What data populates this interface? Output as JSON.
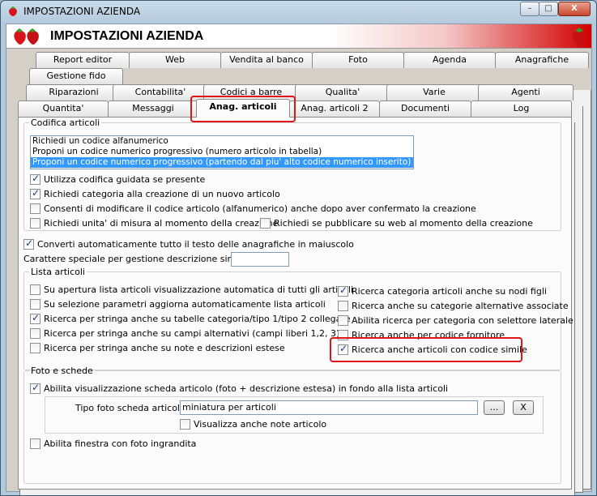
{
  "window": {
    "title": "IMPOSTAZIONI AZIENDA",
    "header_title": "IMPOSTAZIONI AZIENDA",
    "controls": {
      "minimize": "–",
      "maximize": "□",
      "close": "X"
    }
  },
  "tabs": {
    "row1": [
      "Report editor",
      "Web",
      "Vendita al banco",
      "Foto",
      "Agenda",
      "Anagrafiche"
    ],
    "row1b": [
      "Gestione fido"
    ],
    "row2": [
      "Riparazioni",
      "Contabilita'",
      "Codici a barre",
      "Qualita'",
      "Varie",
      "Agenti"
    ],
    "row3": [
      "Quantita'",
      "Messaggi",
      "Anag. articoli",
      "Anag. articoli 2",
      "Documenti",
      "Log"
    ],
    "active": "Anag. articoli"
  },
  "codifica": {
    "legend": "Codifica articoli",
    "options": [
      "Richiedi un codice alfanumerico",
      "Proponi un codice numerico progressivo (numero articolo in tabella)",
      "Proponi un codice numerico progressivo (partendo dal piu' alto codice numerico inserito)"
    ],
    "selected_index": 2,
    "checks": [
      {
        "label": "Utilizza codifica guidata se presente",
        "checked": true
      },
      {
        "label": "Richiedi categoria alla creazione di un nuovo articolo",
        "checked": true
      },
      {
        "label": "Consenti di modificare il codice articolo (alfanumerico) anche dopo aver confermato la creazione",
        "checked": false
      },
      {
        "label": "Richiedi unita' di misura al momento della creazione",
        "checked": false
      },
      {
        "label": "Richiedi se pubblicare su web al momento della creazione",
        "checked": false
      }
    ]
  },
  "maiuscolo": {
    "label": "Converti automaticamente tutto il testo delle anagrafiche in maiuscolo",
    "checked": true
  },
  "carattere": {
    "label": "Carattere speciale per gestione descrizione sintetica :",
    "value": ""
  },
  "lista": {
    "legend": "Lista articoli",
    "left": [
      {
        "label": "Su apertura lista articoli visualizzazione automatica di tutti gli articoli",
        "checked": false
      },
      {
        "label": "Su selezione parametri aggiorna automaticamente lista articoli",
        "checked": false
      },
      {
        "label": "Ricerca per stringa anche su tabelle categoria/tipo 1/tipo 2 collegate",
        "checked": true
      },
      {
        "label": "Ricerca per stringa anche su campi alternativi (campi liberi 1,2, 3)",
        "checked": false
      },
      {
        "label": "Ricerca per stringa anche su note e descrizioni estese",
        "checked": false
      }
    ],
    "right": [
      {
        "label": "Ricerca categoria articoli anche su nodi figli",
        "checked": true
      },
      {
        "label": "Ricerca anche su categorie alternative associate",
        "checked": false
      },
      {
        "label": "Abilita ricerca per categoria con selettore laterale",
        "checked": false
      },
      {
        "label": "Ricerca anche per codice fornitore",
        "checked": false
      },
      {
        "label": "Ricerca anche articoli con codice simile",
        "checked": true
      }
    ]
  },
  "foto": {
    "legend": "Foto e schede",
    "abilita": {
      "label": "Abilita visualizzazione scheda articolo (foto + descrizione estesa) in fondo alla lista articoli",
      "checked": true
    },
    "tipo_label": "Tipo foto scheda articolo :",
    "tipo_value": "miniatura per articoli",
    "browse_label": "...",
    "clear_label": "X",
    "note": {
      "label": "Visualizza anche note articolo",
      "checked": false
    },
    "finestra": {
      "label": "Abilita finestra con foto ingrandita",
      "checked": false
    }
  }
}
